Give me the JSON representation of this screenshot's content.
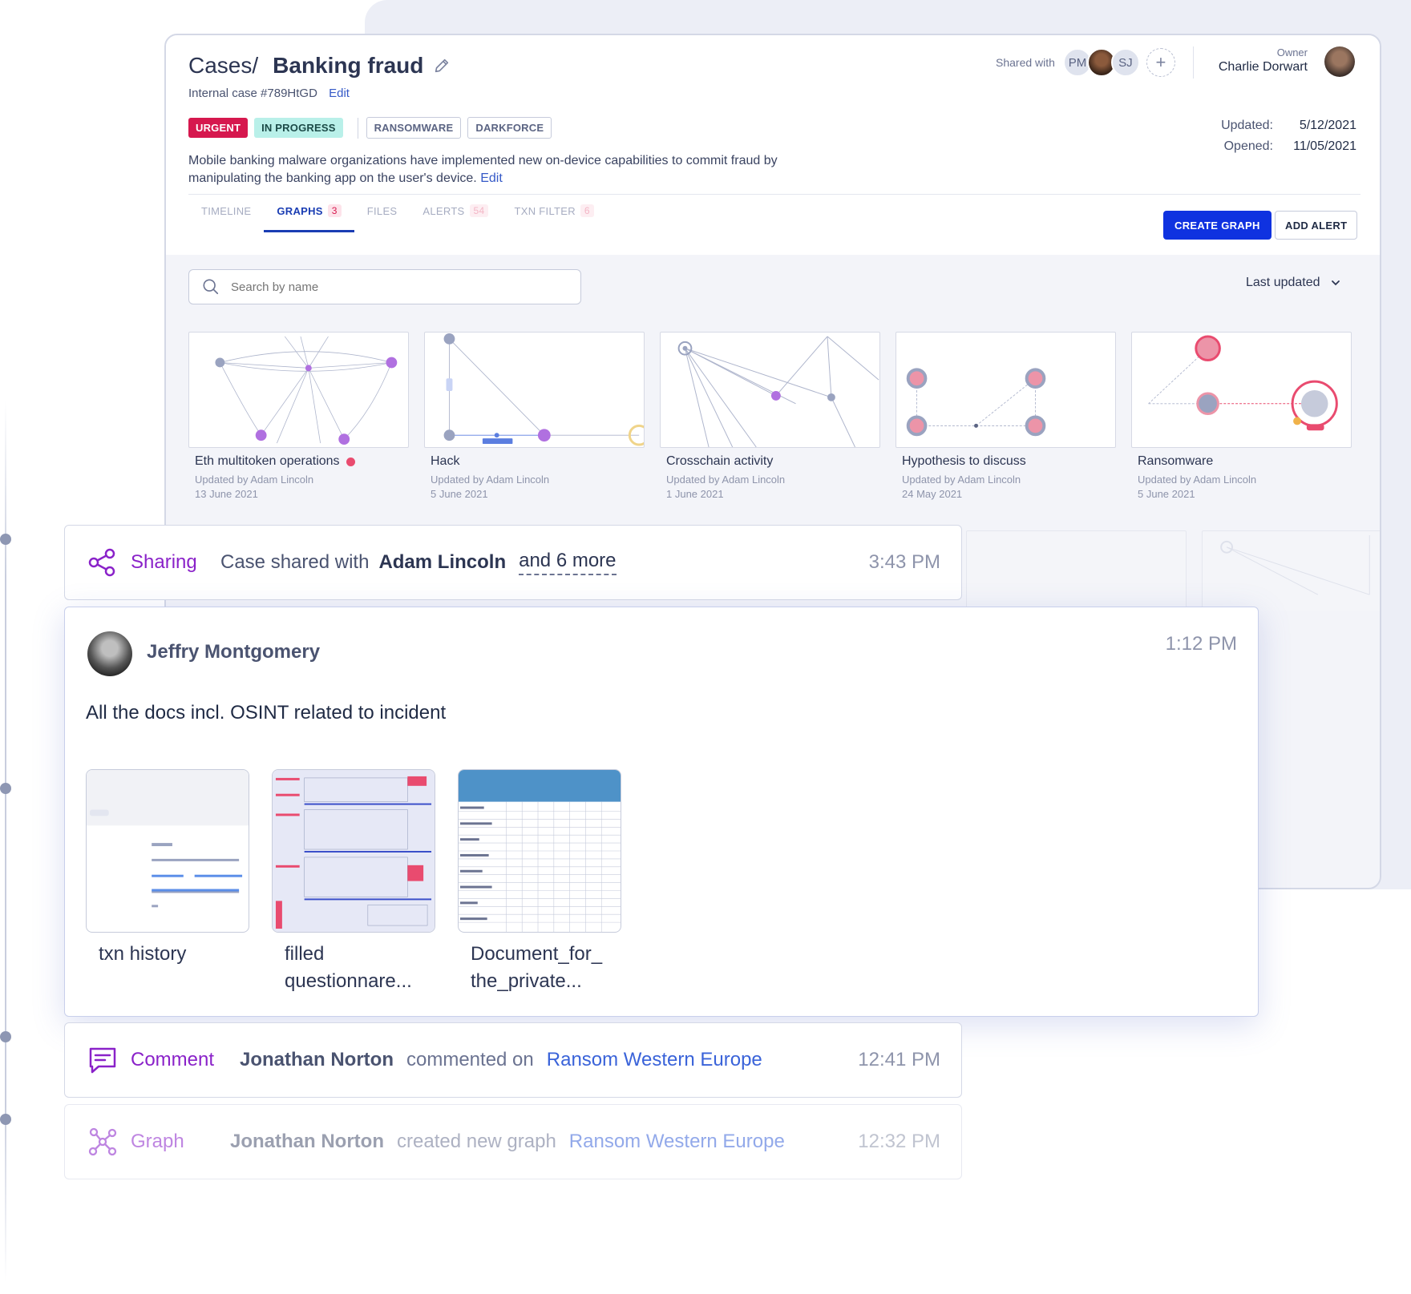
{
  "case": {
    "crumb": "Cases/",
    "name": "Banking fraud",
    "internal_id": "Internal case #789HtGD",
    "edit_label": "Edit",
    "tags": [
      "URGENT",
      "IN PROGRESS",
      "RANSOMWARE",
      "DARKFORCE"
    ],
    "description": "Mobile banking malware organizations have implemented new on-device capabilities to commit fraud by manipulating the banking app on the user's device.",
    "desc_edit": "Edit",
    "shared_with_label": "Shared with",
    "shared_with": [
      "PM",
      "SJ"
    ],
    "owner_label": "Owner",
    "owner_name": "Charlie Dorwart",
    "updated_label": "Updated:",
    "updated": "5/12/2021",
    "opened_label": "Opened:",
    "opened": "11/05/2021"
  },
  "tabs": [
    {
      "label": "TIMELINE",
      "count": ""
    },
    {
      "label": "GRAPHS",
      "count": "3"
    },
    {
      "label": "FILES",
      "count": ""
    },
    {
      "label": "ALERTS",
      "count": "54"
    },
    {
      "label": "TXN FILTER",
      "count": "6"
    }
  ],
  "actions": {
    "create_graph": "CREATE GRAPH",
    "add_alert": "ADD ALERT"
  },
  "search": {
    "placeholder": "Search by name"
  },
  "sort": {
    "label": "Last updated"
  },
  "graphs": [
    {
      "title": "Eth multitoken operations",
      "updated_by": "Updated by Adam Lincoln",
      "date": "13 June 2021"
    },
    {
      "title": "Hack",
      "updated_by": "Updated by Adam Lincoln",
      "date": "5 June 2021"
    },
    {
      "title": "Crosschain activity",
      "updated_by": "Updated by Adam Lincoln",
      "date": "1 June 2021"
    },
    {
      "title": "Hypothesis to discuss",
      "updated_by": "Updated by Adam Lincoln",
      "date": "24 May 2021"
    },
    {
      "title": "Ransomware",
      "updated_by": "Updated by Adam Lincoln",
      "date": "5 June 2021"
    }
  ],
  "activity": {
    "sharing": {
      "kind": "Sharing",
      "text": "Case shared with",
      "who": "Adam Lincoln",
      "more": "and 6 more",
      "time": "3:43 PM"
    },
    "comment_card": {
      "author": "Jeffry Montgomery",
      "time": "1:12 PM",
      "message": "All the docs incl. OSINT related to incident",
      "attachments": [
        {
          "name": "txn history"
        },
        {
          "name": "filled questionnare..."
        },
        {
          "name": "Document_for_ the_private..."
        }
      ]
    },
    "comment": {
      "kind": "Comment",
      "who": "Jonathan Norton",
      "verb": "commented on",
      "target": "Ransom Western Europe",
      "time": "12:41 PM"
    },
    "graph": {
      "kind": "Graph",
      "who": "Jonathan Norton",
      "verb": "created new graph",
      "target": "Ransom Western Europe",
      "time": "12:32 PM"
    }
  },
  "colors": {
    "primary": "#0f32e0",
    "urgent": "#d6184e",
    "in_progress": "#b9f0e9",
    "accent_purple": "#8a22c9",
    "link": "#3559c7"
  }
}
